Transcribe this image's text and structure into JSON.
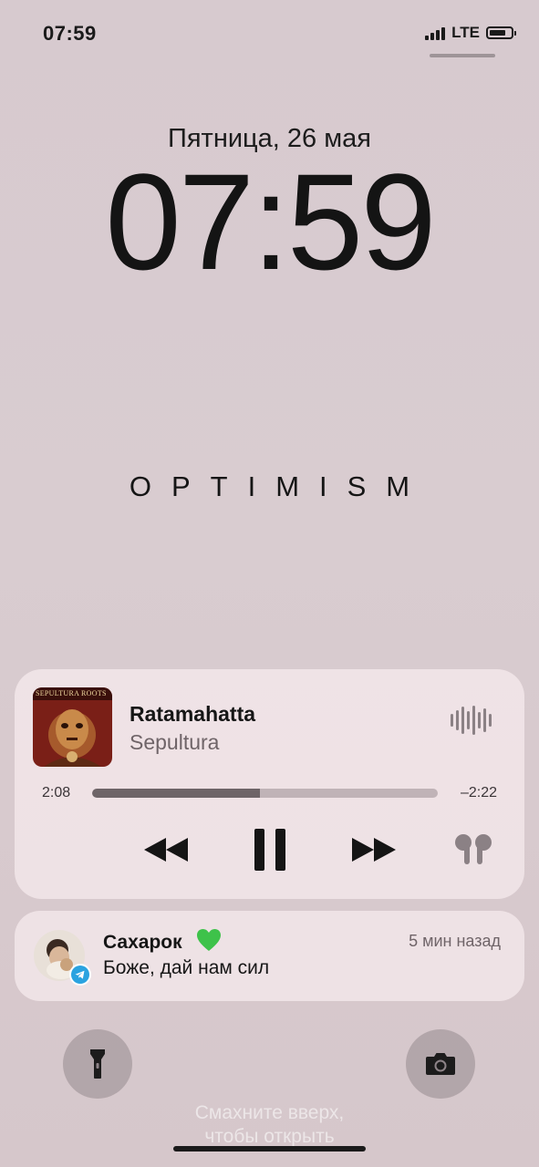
{
  "status_bar": {
    "time": "07:59",
    "network": "LTE",
    "signal_bars": 4,
    "battery_level": 0.75
  },
  "lock_screen": {
    "date": "Пятница, 26 мая",
    "clock": "07:59",
    "wallpaper_text": "OPTIMISM",
    "swipe_hint_line1": "Смахните вверх,",
    "swipe_hint_line2": "чтобы открыть"
  },
  "now_playing": {
    "title": "Ratamahatta",
    "artist": "Sepultura",
    "album_cover_text": "SEPULTURA ROOTS",
    "elapsed": "2:08",
    "remaining": "–2:22",
    "progress": 0.485,
    "controls": [
      "rewind-icon",
      "pause-icon",
      "fast-forward-icon",
      "airpods-icon"
    ]
  },
  "notification": {
    "app_icon": "telegram-icon",
    "sender": "Сахарок",
    "emoji": "green-heart",
    "time": "5 мин назад",
    "message": "Боже, дай нам сил"
  },
  "colors": {
    "background": "#d9ccd0",
    "card": "#f5e9ec",
    "progress_played": "#6e6467",
    "progress_track": "#c0b3b7",
    "telegram_blue": "#2aa3e0",
    "heart_green": "#3ec24a"
  }
}
